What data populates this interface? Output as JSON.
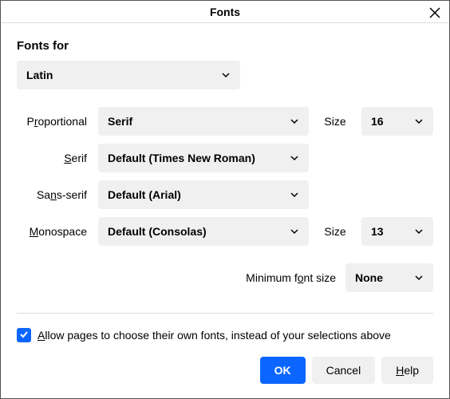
{
  "title": "Fonts",
  "section_label": "Fonts for",
  "language": "Latin",
  "rows": {
    "proportional": {
      "label_pre": "P",
      "label_u": "r",
      "label_post": "oportional",
      "value": "Serif"
    },
    "serif": {
      "label_pre": "",
      "label_u": "S",
      "label_post": "erif",
      "value": "Default (Times New Roman)"
    },
    "sansserif": {
      "label_pre": "Sa",
      "label_u": "n",
      "label_post": "s-serif",
      "value": "Default (Arial)"
    },
    "monospace": {
      "label_pre": "",
      "label_u": "M",
      "label_post": "onospace",
      "value": "Default (Consolas)"
    }
  },
  "size_label": "Size",
  "proportional_size": "16",
  "monospace_size": "13",
  "min_font": {
    "label_pre": "Minimum f",
    "label_u": "o",
    "label_post": "nt size",
    "value": "None"
  },
  "checkbox": {
    "pre": "",
    "u": "A",
    "post": "llow pages to choose their own fonts, instead of your selections above",
    "checked": true
  },
  "buttons": {
    "ok": "OK",
    "cancel": "Cancel",
    "help_pre": "",
    "help_u": "H",
    "help_post": "elp"
  }
}
